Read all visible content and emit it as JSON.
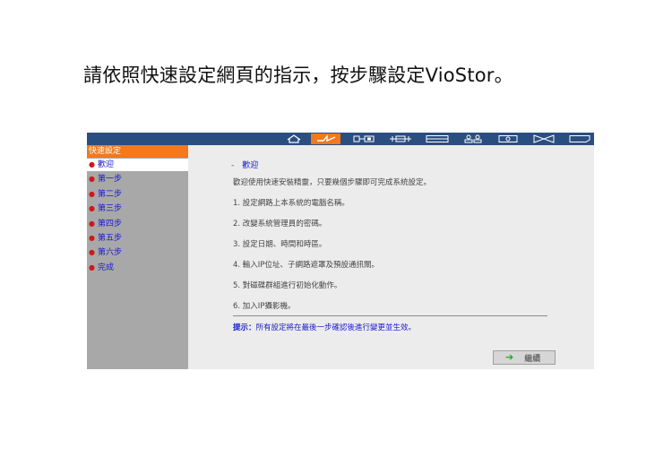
{
  "instruction": "請依照快速設定網頁的指示，按步驟設定VioStor。",
  "toolbar": {
    "icons": [
      "home-icon",
      "quick-config-icon",
      "system-settings-icon",
      "network-icon",
      "device-config-icon",
      "user-management-icon",
      "camera-settings-icon",
      "system-tools-icon",
      "logs-icon"
    ],
    "active_icon": "quick-config-icon",
    "accent_color": "#f2791e",
    "bar_color": "#2b4e80"
  },
  "sidebar": {
    "title": "快速設定",
    "items": [
      {
        "label": "歡迎"
      },
      {
        "label": "第一步"
      },
      {
        "label": "第二步"
      },
      {
        "label": "第三步"
      },
      {
        "label": "第四步"
      },
      {
        "label": "第五步"
      },
      {
        "label": "第六步"
      },
      {
        "label": "完成"
      }
    ]
  },
  "content": {
    "heading": "歡迎",
    "intro": "歡迎使用快速安裝精靈，只要幾個步驟即可完成系統設定。",
    "steps": [
      "1. 設定網路上本系統的電腦名稱。",
      "2. 改變系統管理員的密碼。",
      "3. 設定日期、時間和時區。",
      "4. 輸入IP位址、子網路遮罩及預設通訊閘。",
      "5. 對磁碟群組進行初始化動作。",
      "6. 加入IP攝影機。"
    ],
    "tip_label": "提示：",
    "tip_text": "所有設定將在最後一步確認後進行變更並生效。",
    "next_label": "繼續"
  }
}
